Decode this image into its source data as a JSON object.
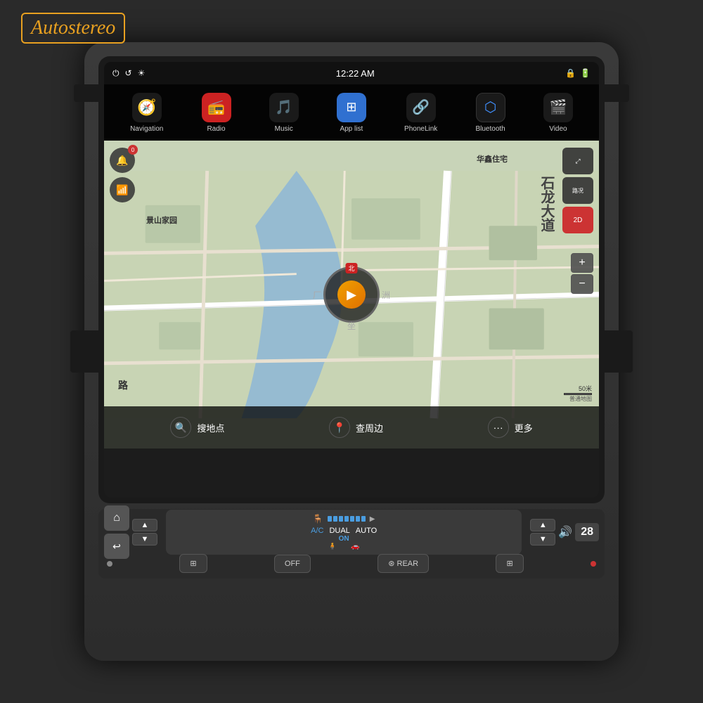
{
  "brand": {
    "name": "Autostereo"
  },
  "statusBar": {
    "time": "12:22 AM",
    "icons": [
      "power",
      "undo",
      "brightness",
      "lock",
      "battery"
    ]
  },
  "appBar": {
    "items": [
      {
        "id": "navigation",
        "label": "Navigation",
        "icon": "🧭",
        "color": "#e8a020",
        "bg": "#1a1a1a"
      },
      {
        "id": "radio",
        "label": "Radio",
        "icon": "📻",
        "color": "#e03030",
        "bg": "#cc2222"
      },
      {
        "id": "music",
        "label": "Music",
        "icon": "🎵",
        "color": "#e08020",
        "bg": "#d07020"
      },
      {
        "id": "applist",
        "label": "App list",
        "icon": "⊞",
        "color": "#4080e0",
        "bg": "#3070d0"
      },
      {
        "id": "phonelink",
        "label": "PhoneLink",
        "icon": "🔗",
        "color": "#30c030",
        "bg": "#20a020"
      },
      {
        "id": "bluetooth",
        "label": "Bluetooth",
        "icon": "⬡",
        "color": "#4090ff",
        "bg": "#1a1a1a"
      },
      {
        "id": "video",
        "label": "Video",
        "icon": "🎬",
        "color": "#9040d0",
        "bg": "#8030c0"
      }
    ]
  },
  "map": {
    "labels": {
      "huaxin": "华鑫住宅",
      "jingshan": "景山家园",
      "roadName": "石龙大道",
      "north": "北",
      "left1": "厂",
      "left2": "洲",
      "bottom1": "搜地点",
      "bottom2": "查周边",
      "bottom3": "更多",
      "road_bottom": "路"
    },
    "rightControls": [
      {
        "label": "⤢",
        "type": "normal"
      },
      {
        "label": "路况",
        "type": "normal"
      },
      {
        "label": "2D",
        "type": "red"
      }
    ],
    "zoom": {
      "plus": "+",
      "minus": "−",
      "scale": "50米",
      "scaleLabel": "普通地图"
    },
    "leftControls": [
      {
        "label": "🔔",
        "badge": "0"
      },
      {
        "label": "📶"
      }
    ]
  },
  "acPanel": {
    "acLabel": "A/C",
    "dualLabel": "DUAL",
    "autoLabel": "AUTO",
    "onLabel": "ON",
    "fanLevels": 7
  },
  "volumeControl": {
    "icon": "🔊",
    "level": "28"
  },
  "bottomButtons": [
    {
      "id": "dot1",
      "label": "·",
      "type": "dot"
    },
    {
      "id": "grid1",
      "label": "⊞",
      "type": "grid"
    },
    {
      "id": "off",
      "label": "OFF",
      "type": "text"
    },
    {
      "id": "rear",
      "label": "⊛ REAR",
      "type": "text"
    },
    {
      "id": "grid2",
      "label": "⊞",
      "type": "grid"
    },
    {
      "id": "dot2",
      "label": "·",
      "type": "dot-red"
    }
  ],
  "navButtons": {
    "home": "⌂",
    "back": "↩"
  },
  "upDownButtons": {
    "up": "▲",
    "down": "▼"
  }
}
